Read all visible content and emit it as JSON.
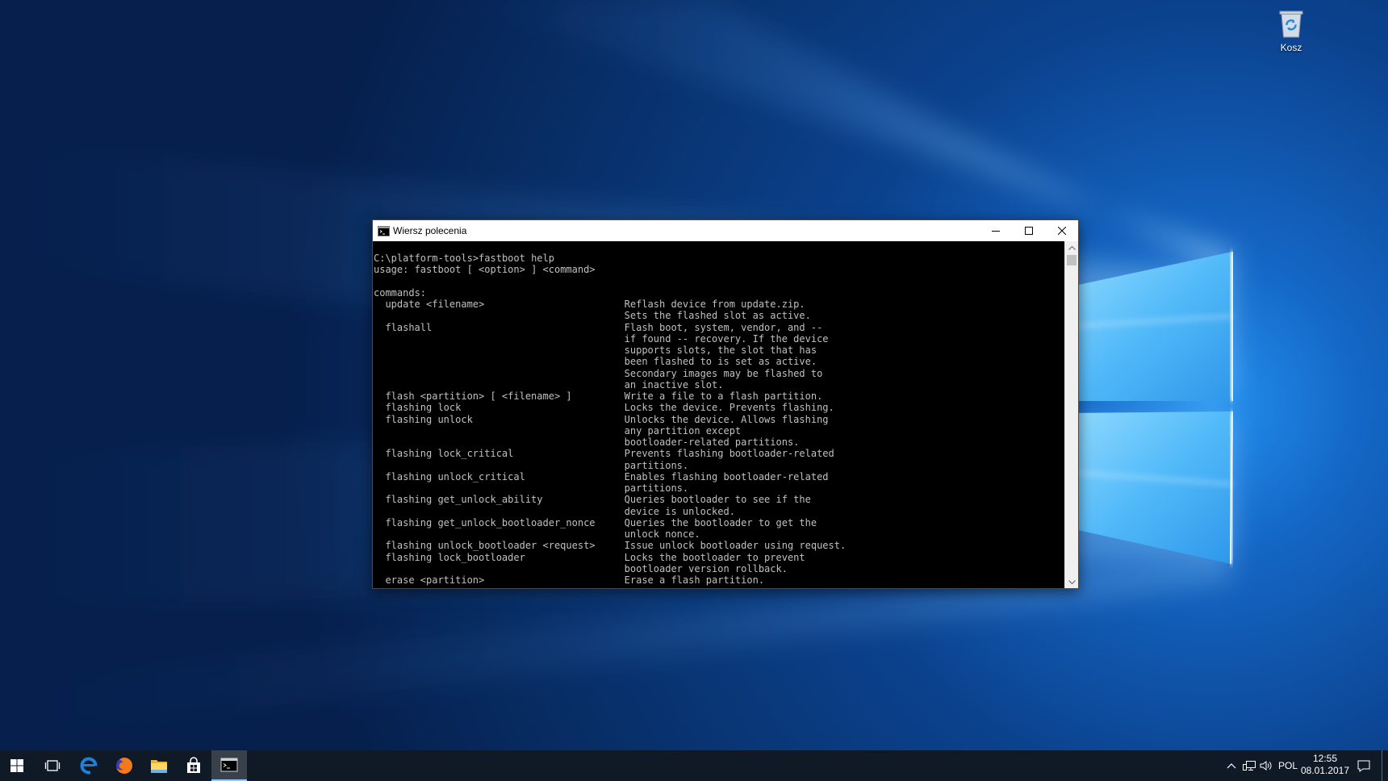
{
  "desktop": {
    "icons": [
      {
        "label": "Kosz",
        "icon": "recycle-bin-icon"
      }
    ]
  },
  "console_window": {
    "title": "Wiersz polecenia",
    "app_icon": "command-prompt-icon",
    "controls": [
      "minimize-icon",
      "maximize-icon",
      "close-icon"
    ],
    "prompt_line": "C:\\platform-tools>fastboot help",
    "usage_line": "usage: fastboot [ <option> ] <command>",
    "commands_header": "commands:",
    "commands": [
      {
        "name": "update <filename>",
        "description": [
          "Reflash device from update.zip.",
          "Sets the flashed slot as active."
        ]
      },
      {
        "name": "flashall",
        "description": [
          "Flash boot, system, vendor, and --",
          "if found -- recovery. If the device",
          "supports slots, the slot that has",
          "been flashed to is set as active.",
          "Secondary images may be flashed to",
          "an inactive slot."
        ]
      },
      {
        "name": "flash <partition> [ <filename> ]",
        "description": [
          "Write a file to a flash partition."
        ]
      },
      {
        "name": "flashing lock",
        "description": [
          "Locks the device. Prevents flashing."
        ]
      },
      {
        "name": "flashing unlock",
        "description": [
          "Unlocks the device. Allows flashing",
          "any partition except",
          "bootloader-related partitions."
        ]
      },
      {
        "name": "flashing lock_critical",
        "description": [
          "Prevents flashing bootloader-related",
          "partitions."
        ]
      },
      {
        "name": "flashing unlock_critical",
        "description": [
          "Enables flashing bootloader-related",
          "partitions."
        ]
      },
      {
        "name": "flashing get_unlock_ability",
        "description": [
          "Queries bootloader to see if the",
          "device is unlocked."
        ]
      },
      {
        "name": "flashing get_unlock_bootloader_nonce",
        "description": [
          "Queries the bootloader to get the",
          "unlock nonce."
        ]
      },
      {
        "name": "flashing unlock_bootloader <request>",
        "description": [
          "Issue unlock bootloader using request."
        ]
      },
      {
        "name": "flashing lock_bootloader",
        "description": [
          "Locks the bootloader to prevent",
          "bootloader version rollback."
        ]
      },
      {
        "name": "erase <partition>",
        "description": [
          "Erase a flash partition."
        ]
      }
    ],
    "colors": {
      "background": "#000000",
      "text": "#c0c0c0",
      "titlebar": "#ffffff"
    }
  },
  "taskbar": {
    "pinned_icons": [
      "windows-start-icon",
      "task-view-icon",
      "edge-browser-icon",
      "firefox-icon",
      "file-explorer-icon",
      "store-icon",
      "command-prompt-icon"
    ],
    "active_app_icon": "command-prompt-icon",
    "colors": {
      "background": "#101a27",
      "active_indicator": "#90c6f3"
    },
    "tray": {
      "icons": [
        "chevron-up-icon",
        "network-icon",
        "volume-icon",
        "action-center-icon"
      ],
      "language": "POL",
      "time": "12:55",
      "date": "08.01.2017"
    }
  }
}
